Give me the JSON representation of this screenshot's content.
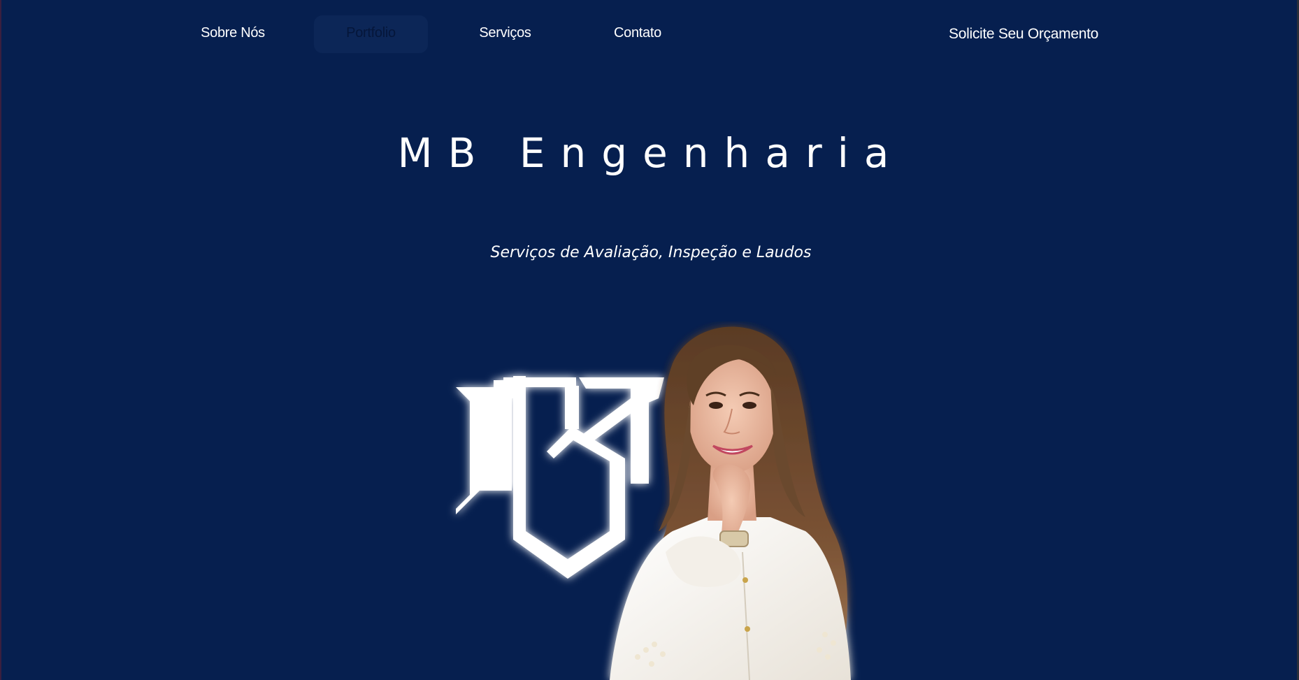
{
  "nav": {
    "items": [
      {
        "label": "Sobre Nós"
      },
      {
        "label": "Portfolio"
      },
      {
        "label": "Serviços"
      },
      {
        "label": "Contato"
      }
    ],
    "cta_label": "Solicite Seu Orçamento"
  },
  "hero": {
    "title": "MB Engenharia",
    "subtitle": "Serviços de Avaliação, Inspeção e Laudos"
  },
  "colors": {
    "background": "#061f4f",
    "text": "#ffffff",
    "active_tab_bg": "#0c2657"
  }
}
